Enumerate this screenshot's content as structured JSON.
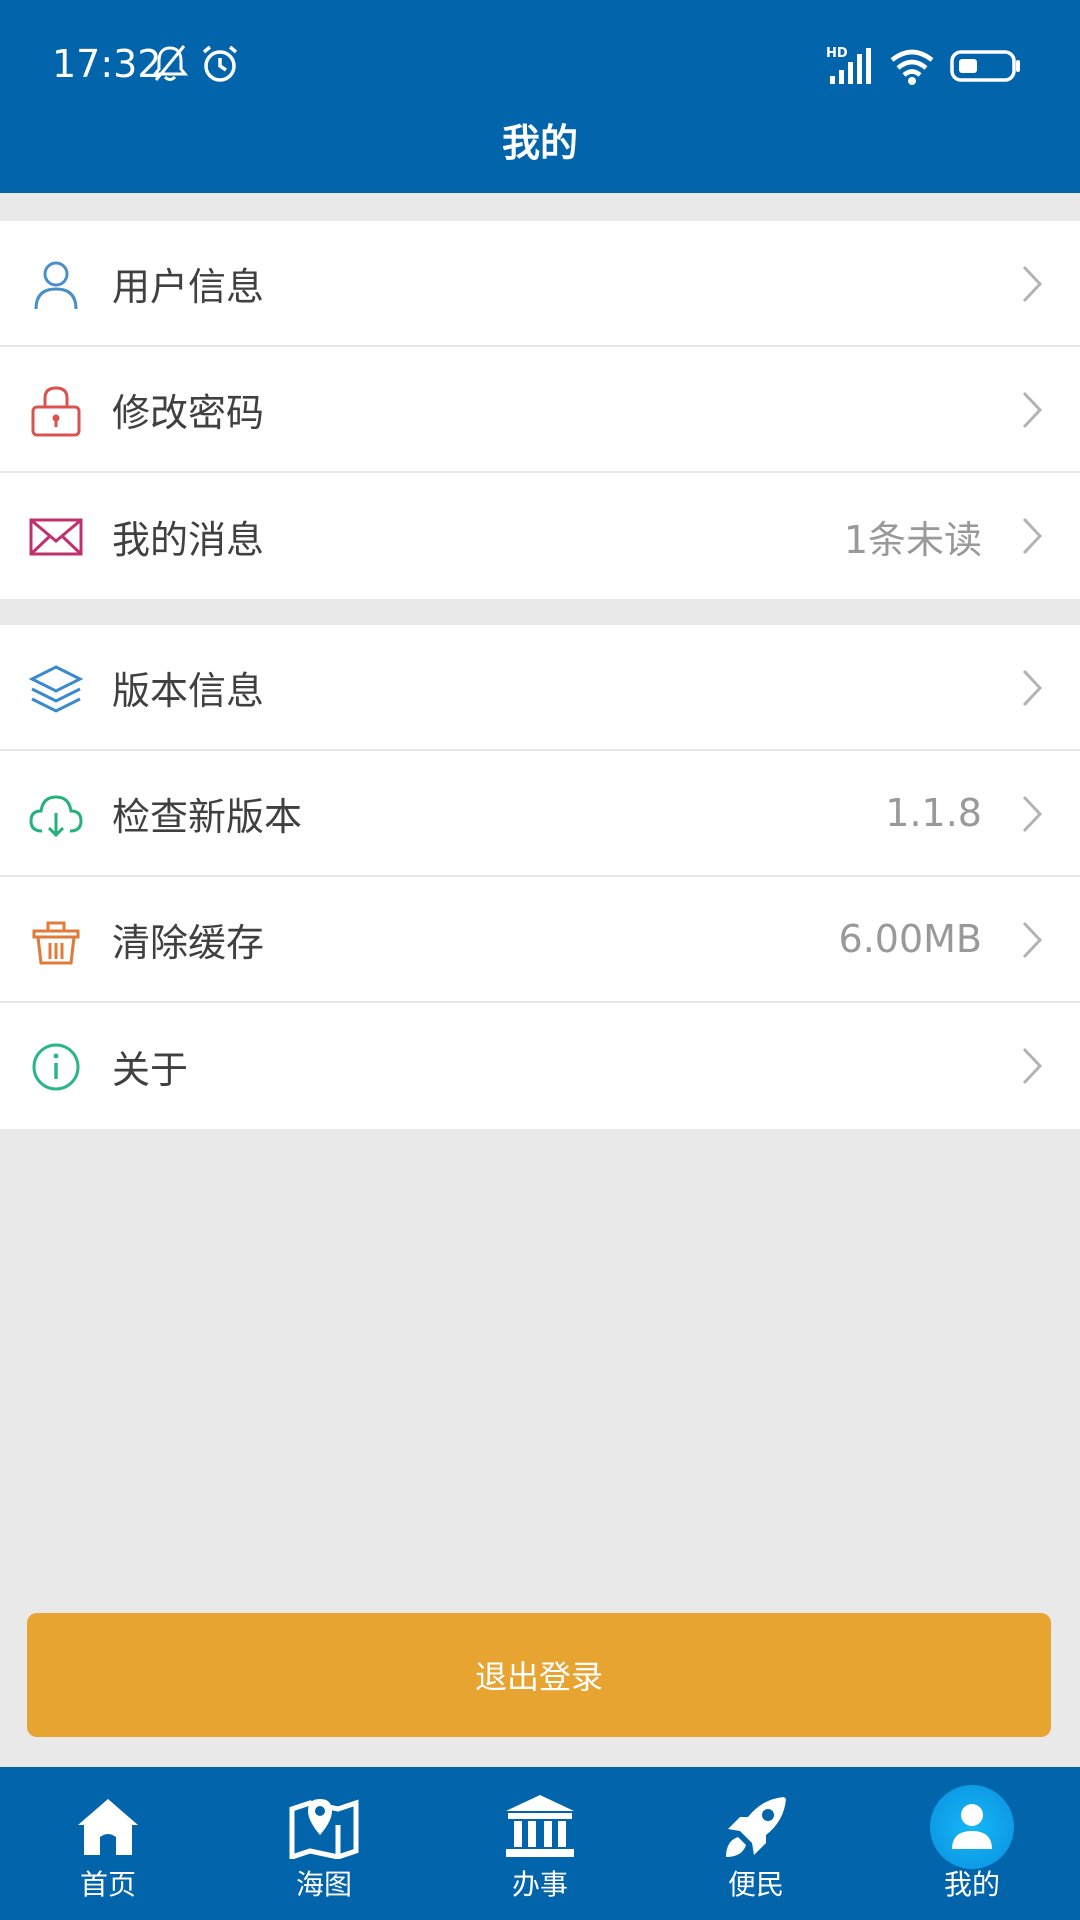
{
  "status_bar": {
    "time": "17:32",
    "icons": [
      "bell-muted-icon",
      "alarm-icon",
      "hd-signal-icon",
      "wifi-icon",
      "battery-icon"
    ],
    "signal_badge": "HD"
  },
  "header": {
    "title": "我的"
  },
  "menu_group_1": [
    {
      "label": "用户信息",
      "value": "",
      "icon": "user-icon",
      "color": "#4a90c8"
    },
    {
      "label": "修改密码",
      "value": "",
      "icon": "lock-icon",
      "color": "#d9534f"
    },
    {
      "label": "我的消息",
      "value": "1条未读",
      "icon": "mail-icon",
      "color": "#c0306e"
    }
  ],
  "menu_group_2": [
    {
      "label": "版本信息",
      "value": "",
      "icon": "layers-icon",
      "color": "#3a8ad0"
    },
    {
      "label": "检查新版本",
      "value": "1.1.8",
      "icon": "cloud-download-icon",
      "color": "#26b07a"
    },
    {
      "label": "清除缓存",
      "value": "6.00MB",
      "icon": "basket-icon",
      "color": "#e07b39"
    },
    {
      "label": "关于",
      "value": "",
      "icon": "info-icon",
      "color": "#2bb58a"
    }
  ],
  "logout": {
    "label": "退出登录",
    "color": "#e8a431"
  },
  "tabbar": {
    "tabs": [
      {
        "label": "首页",
        "icon": "home-icon"
      },
      {
        "label": "海图",
        "icon": "map-icon"
      },
      {
        "label": "办事",
        "icon": "bank-icon"
      },
      {
        "label": "便民",
        "icon": "rocket-icon"
      },
      {
        "label": "我的",
        "icon": "person-icon",
        "active": true
      }
    ]
  },
  "colors": {
    "primary": "#0264aa",
    "background": "#e9e9e9",
    "accent": "#e8a431"
  }
}
